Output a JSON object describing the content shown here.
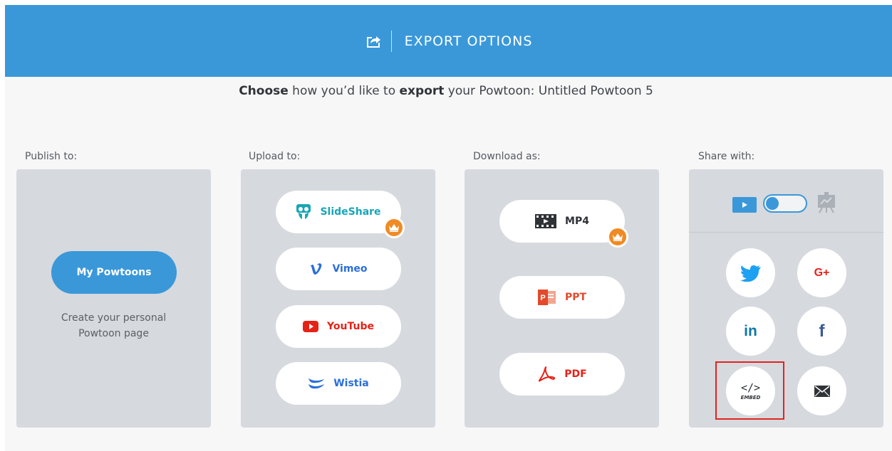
{
  "header": {
    "title": "EXPORT OPTIONS",
    "icon": "share-export-icon"
  },
  "subtitle": {
    "choose": "Choose",
    "part1": " how you’d like to ",
    "export": "export",
    "part2": " your Powtoon: Untitled Powtoon 5"
  },
  "columns": {
    "publish": {
      "label": "Publish to:",
      "button": "My Powtoons",
      "desc_line1": "Create your personal",
      "desc_line2": "Powtoon page"
    },
    "upload": {
      "label": "Upload to:",
      "items": [
        {
          "label": "SlideShare",
          "icon": "slideshare-icon",
          "color": "#17a6b8",
          "premium": true
        },
        {
          "label": "Vimeo",
          "icon": "vimeo-icon",
          "color": "#2b6fd8",
          "premium": false
        },
        {
          "label": "YouTube",
          "icon": "youtube-icon",
          "color": "#e62117",
          "premium": false
        },
        {
          "label": "Wistia",
          "icon": "wistia-icon",
          "color": "#2b6fd8",
          "premium": false
        }
      ]
    },
    "download": {
      "label": "Download as:",
      "items": [
        {
          "label": "MP4",
          "icon": "film-icon",
          "color": "#2f3338",
          "premium": true
        },
        {
          "label": "PPT",
          "icon": "powerpoint-icon",
          "color": "#e24a2b",
          "premium": false
        },
        {
          "label": "PDF",
          "icon": "pdf-icon",
          "color": "#e62117",
          "premium": false
        }
      ]
    },
    "share": {
      "label": "Share with:",
      "toggle": {
        "left_icon": "video-play-icon",
        "right_icon": "presentation-icon",
        "state": "video"
      },
      "buttons": [
        {
          "name": "twitter",
          "icon": "twitter-icon",
          "color": "#1da1f2"
        },
        {
          "name": "google-plus",
          "icon": "google-plus-icon",
          "label": "G+",
          "color": "#e62117"
        },
        {
          "name": "linkedin",
          "icon": "linkedin-icon",
          "label": "in",
          "color": "#0e76a8"
        },
        {
          "name": "facebook",
          "icon": "facebook-icon",
          "label": "f",
          "color": "#3b5998"
        },
        {
          "name": "embed",
          "icon": "embed-code-icon",
          "code": "</>",
          "label": "EMBED",
          "color": "#2f3338"
        },
        {
          "name": "email",
          "icon": "envelope-icon",
          "color": "#2f3338"
        }
      ]
    }
  },
  "colors": {
    "accent": "#3a98d9",
    "panel": "#d6d9de",
    "premium": "#f08a24",
    "highlight": "#e0241f"
  }
}
